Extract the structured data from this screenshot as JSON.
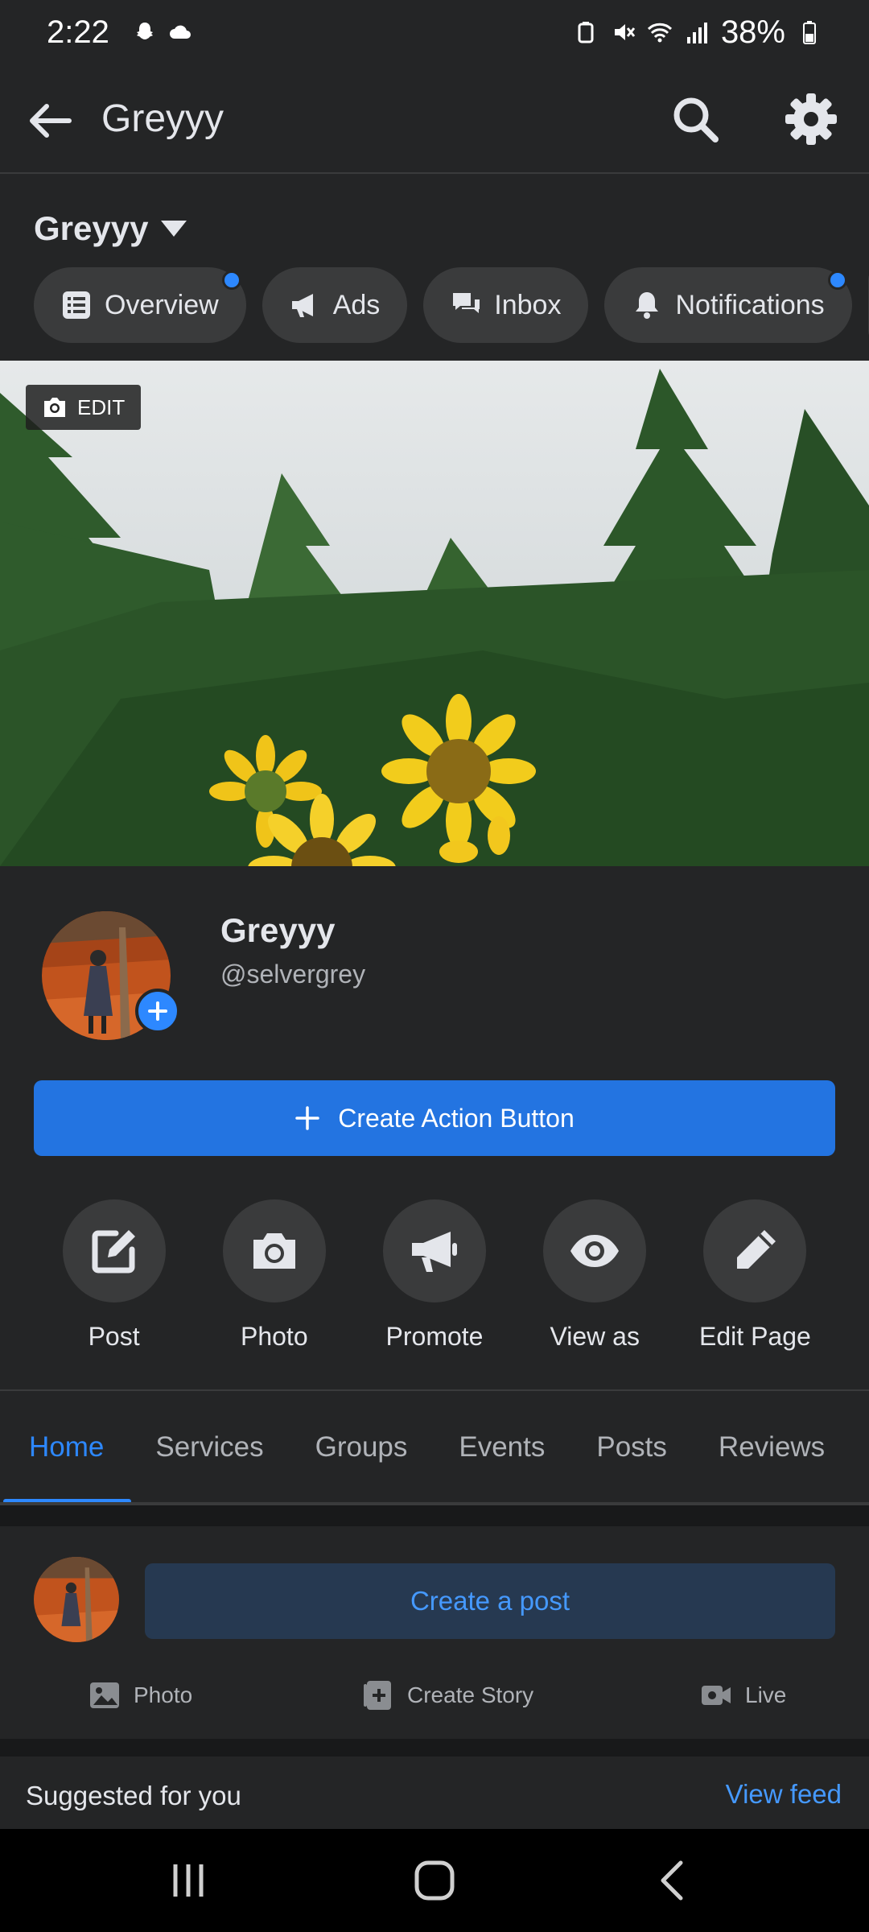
{
  "status": {
    "time": "2:22",
    "battery": "38%"
  },
  "topbar": {
    "title": "Greyyy"
  },
  "page_switcher": {
    "name": "Greyyy"
  },
  "chips": [
    {
      "label": "Overview",
      "dot": true
    },
    {
      "label": "Ads",
      "dot": false
    },
    {
      "label": "Inbox",
      "dot": false
    },
    {
      "label": "Notifications",
      "dot": true
    }
  ],
  "cover": {
    "edit_label": "EDIT"
  },
  "profile": {
    "name": "Greyyy",
    "handle": "@selvergrey"
  },
  "cta": {
    "label": "Create Action Button"
  },
  "actions": [
    {
      "label": "Post",
      "icon": "edit-square-icon"
    },
    {
      "label": "Photo",
      "icon": "camera-icon"
    },
    {
      "label": "Promote",
      "icon": "megaphone-icon"
    },
    {
      "label": "View as",
      "icon": "eye-icon"
    },
    {
      "label": "Edit Page",
      "icon": "pencil-icon"
    }
  ],
  "tabs": [
    "Home",
    "Services",
    "Groups",
    "Events",
    "Posts",
    "Reviews"
  ],
  "active_tab": "Home",
  "composer": {
    "create_post": "Create a post",
    "photo": "Photo",
    "create_story": "Create Story",
    "live": "Live"
  },
  "suggested": {
    "title": "Suggested for you",
    "view_feed": "View feed"
  },
  "colors": {
    "background": "#242526",
    "accent": "#2d88ff",
    "cta": "#2374e1",
    "chip": "#3a3b3c"
  }
}
